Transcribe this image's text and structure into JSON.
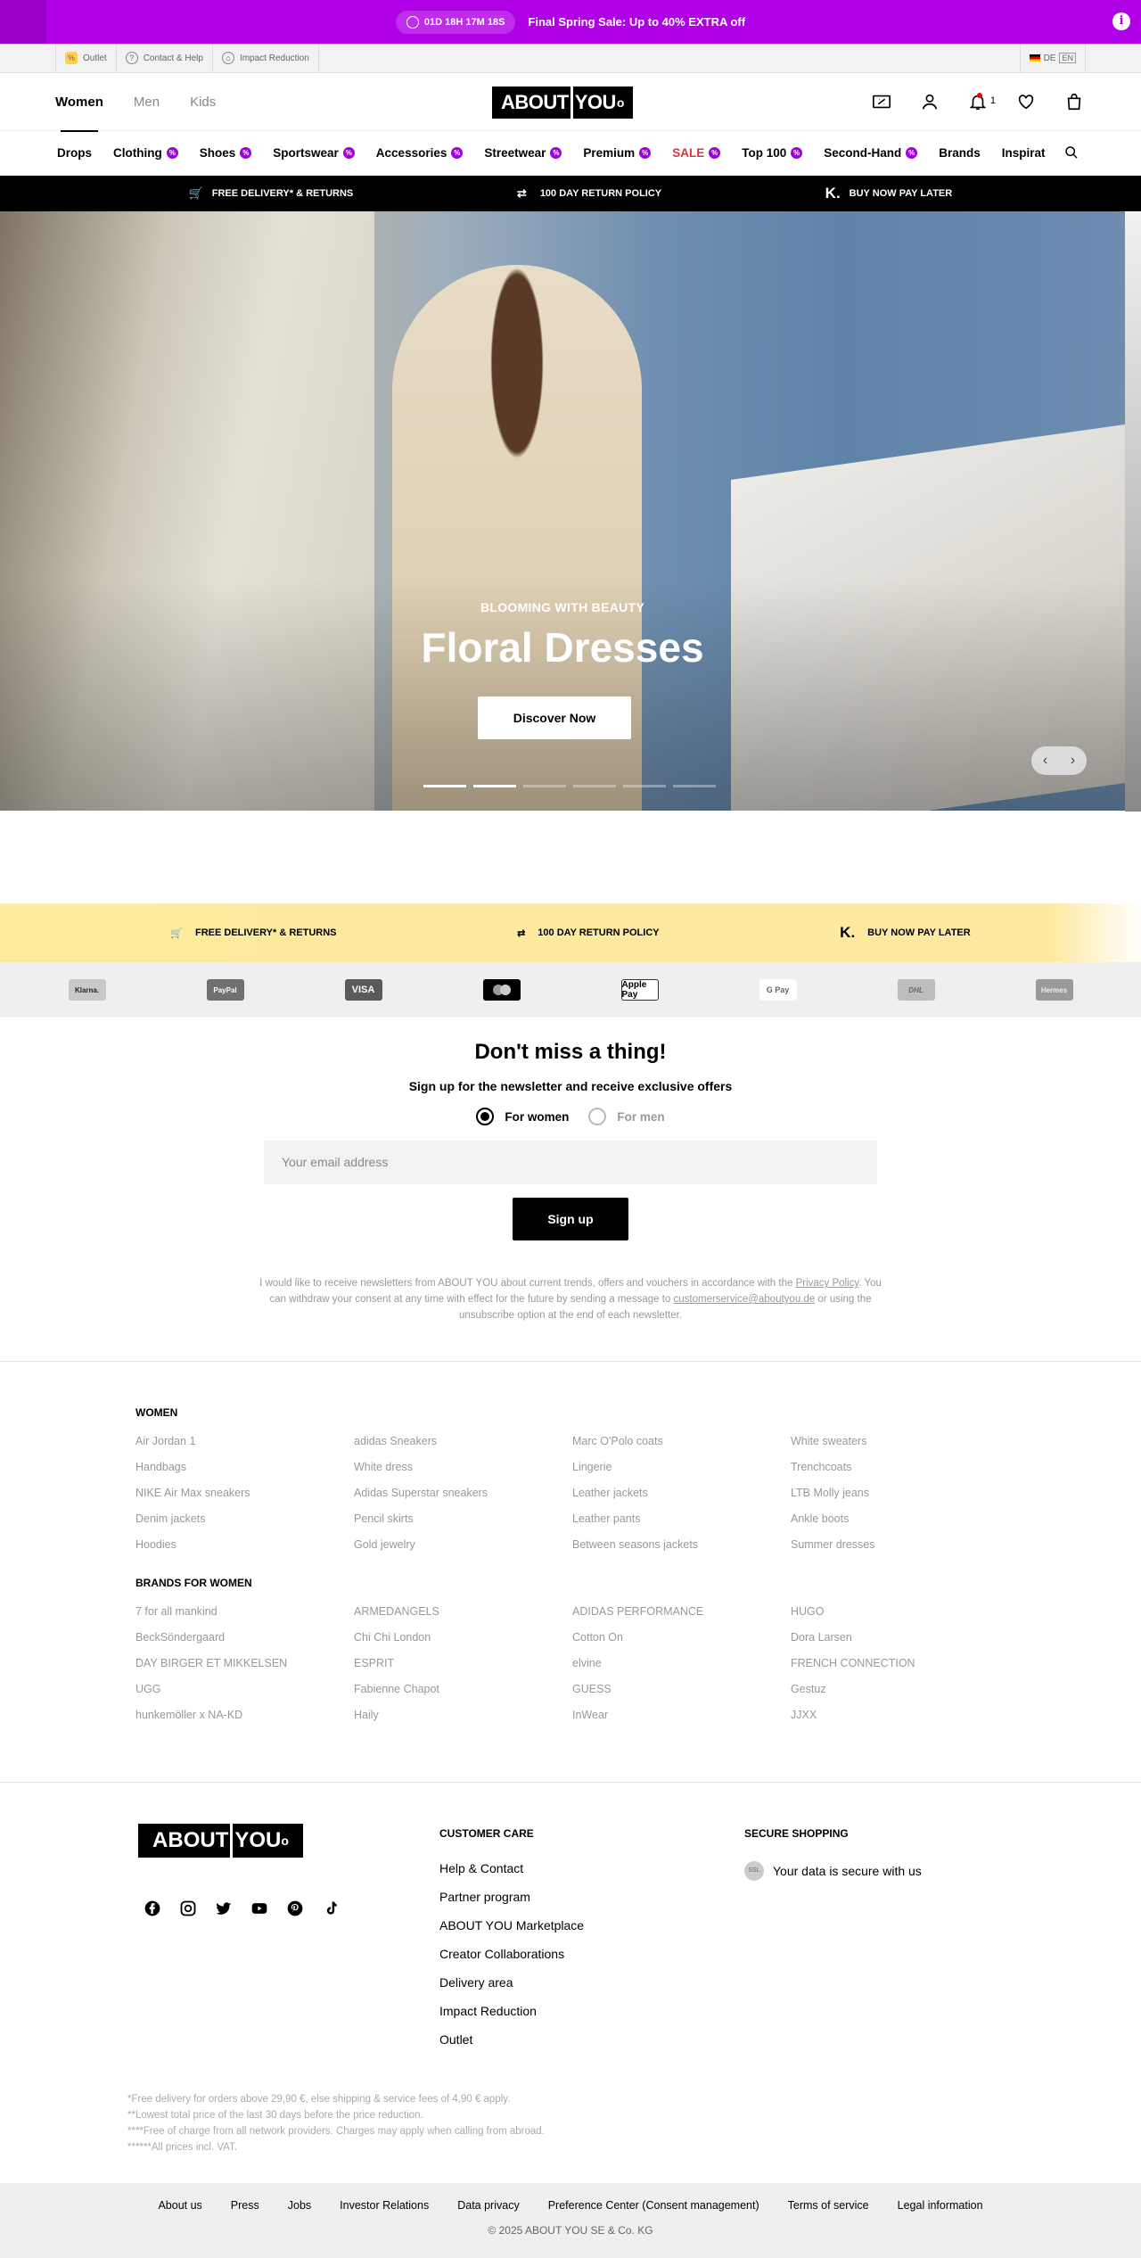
{
  "promo": {
    "countdown": "01D 18H 17M 18S",
    "text": "Final Spring Sale: Up to 40% EXTRA off",
    "info": "i"
  },
  "utility": {
    "outlet": "Outlet",
    "contact": "Contact & Help",
    "impact": "Impact Reduction",
    "lang_de": "DE",
    "lang_en": "EN"
  },
  "header": {
    "tabs": [
      "Women",
      "Men",
      "Kids"
    ],
    "active_tab": "Women",
    "logo_left": "ABOUT",
    "logo_right": "YOU",
    "logo_mark": "o",
    "notification_count": "1"
  },
  "nav": {
    "items": [
      {
        "label": "Drops",
        "badge": false
      },
      {
        "label": "Clothing",
        "badge": true
      },
      {
        "label": "Shoes",
        "badge": true
      },
      {
        "label": "Sportswear",
        "badge": true
      },
      {
        "label": "Accessories",
        "badge": true
      },
      {
        "label": "Streetwear",
        "badge": true
      },
      {
        "label": "Premium",
        "badge": true
      },
      {
        "label": "SALE",
        "badge": true
      },
      {
        "label": "Top 100",
        "badge": true
      },
      {
        "label": "Second-Hand",
        "badge": true
      },
      {
        "label": "Brands",
        "badge": false
      },
      {
        "label": "Inspirat",
        "badge": false
      }
    ]
  },
  "benefits": {
    "delivery": "FREE DELIVERY* & RETURNS",
    "returns": "100 DAY RETURN POLICY",
    "bnpl": "BUY NOW PAY LATER",
    "klarna_mark": "K."
  },
  "hero": {
    "kicker": "BLOOMING WITH BEAUTY",
    "title": "Floral Dresses",
    "cta": "Discover Now",
    "slides_total": 6,
    "active_slide": 2
  },
  "payments": [
    "Klarna.",
    "PayPal",
    "VISA",
    "Mastercard",
    "Apple Pay",
    "G Pay",
    "DHL",
    "Hermes"
  ],
  "newsletter": {
    "title": "Don't miss a thing!",
    "subtitle": "Sign up for the newsletter and receive exclusive offers",
    "option_women": "For women",
    "option_men": "For men",
    "email_placeholder": "Your email address",
    "button": "Sign up",
    "legal_1": "I would like to receive newsletters from ABOUT YOU about current trends, offers and vouchers in accordance with the",
    "legal_privacy": "Privacy Policy",
    "legal_2": ". You can withdraw your consent at any time with effect for the future by sending a message to",
    "legal_email": "customerservice@aboutyou.de",
    "legal_3": "or using the unsubscribe option at the end of each newsletter."
  },
  "seo": {
    "women_title": "WOMEN",
    "women_links": [
      "Air Jordan 1",
      "adidas Sneakers",
      "Marc O'Polo coats",
      "White sweaters",
      "Handbags",
      "White dress",
      "Lingerie",
      "Trenchcoats",
      "NIKE Air Max sneakers",
      "Adidas Superstar sneakers",
      "Leather jackets",
      "LTB Molly jeans",
      "Denim jackets",
      "Pencil skirts",
      "Leather pants",
      "Ankle boots",
      "Hoodies",
      "Gold jewelry",
      "Between seasons jackets",
      "Summer dresses"
    ],
    "brands_title": "BRANDS FOR WOMEN",
    "brand_links": [
      "7 for all mankind",
      "ARMEDANGELS",
      "ADIDAS PERFORMANCE",
      "HUGO",
      "BeckSöndergaard",
      "Chi Chi London",
      "Cotton On",
      "Dora Larsen",
      "DAY BIRGER ET MIKKELSEN",
      "ESPRIT",
      "elvine",
      "FRENCH CONNECTION",
      "UGG",
      "Fabienne Chapot",
      "GUESS",
      "Gestuz",
      "hunkemöller x NA-KD",
      "Haily",
      "InWear",
      "JJXX"
    ]
  },
  "footer": {
    "customer_care_title": "CUSTOMER CARE",
    "customer_care": [
      "Help & Contact",
      "Partner program",
      "ABOUT YOU Marketplace",
      "Creator Collaborations",
      "Delivery area",
      "Impact Reduction",
      "Outlet"
    ],
    "secure_title": "SECURE SHOPPING",
    "secure_text": "Your data is secure with us",
    "ssl_badge": "SSL",
    "notes": [
      "*Free delivery for orders above 29,90 €, else shipping & service fees of 4,90 € apply.",
      "**Lowest total price of the last 30 days before the price reduction.",
      "****Free of charge from all network providers. Charges may apply when calling from abroad.",
      "******All prices incl. VAT."
    ],
    "bottom_links": [
      "About us",
      "Press",
      "Jobs",
      "Investor Relations",
      "Data privacy",
      "Preference Center (Consent management)",
      "Terms of service",
      "Legal information"
    ],
    "copyright": "© 2025 ABOUT YOU SE & Co. KG"
  },
  "colors": {
    "promo": "#b000e6",
    "sale": "#e03040",
    "benefit_bar": "#fdeb9e"
  }
}
